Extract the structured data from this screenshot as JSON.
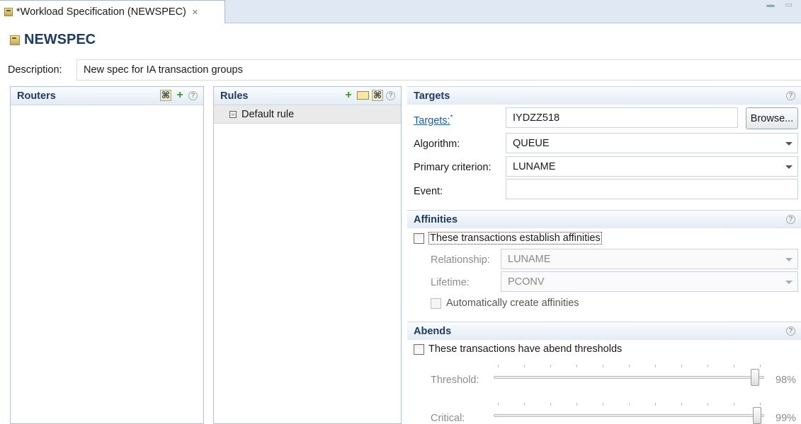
{
  "tab": {
    "title": "*Workload Specification (NEWSPEC)",
    "close": "✕"
  },
  "header": {
    "title": "NEWSPEC"
  },
  "description": {
    "label": "Description:",
    "value": "New spec for IA transaction groups"
  },
  "routers": {
    "title": "Routers"
  },
  "rules": {
    "title": "Rules",
    "items": [
      "Default rule"
    ]
  },
  "targets": {
    "title": "Targets",
    "targets_label": "Targets:",
    "targets_required": "*",
    "targets_value": "IYDZZ518",
    "browse_label": "Browse...",
    "algorithm_label": "Algorithm:",
    "algorithm_value": "QUEUE",
    "primary_label": "Primary criterion:",
    "primary_value": "LUNAME",
    "event_label": "Event:",
    "event_value": ""
  },
  "affinities": {
    "title": "Affinities",
    "checkbox_label": "These transactions establish affinities",
    "relationship_label": "Relationship:",
    "relationship_value": "LUNAME",
    "lifetime_label": "Lifetime:",
    "lifetime_value": "PCONV",
    "auto_label": "Automatically create affinities"
  },
  "abends": {
    "title": "Abends",
    "checkbox_label": "These transactions have abend thresholds",
    "threshold_label": "Threshold:",
    "threshold_value": "98%",
    "threshold_fraction": 0.98,
    "critical_label": "Critical:",
    "critical_value": "99%",
    "critical_fraction": 0.99
  }
}
